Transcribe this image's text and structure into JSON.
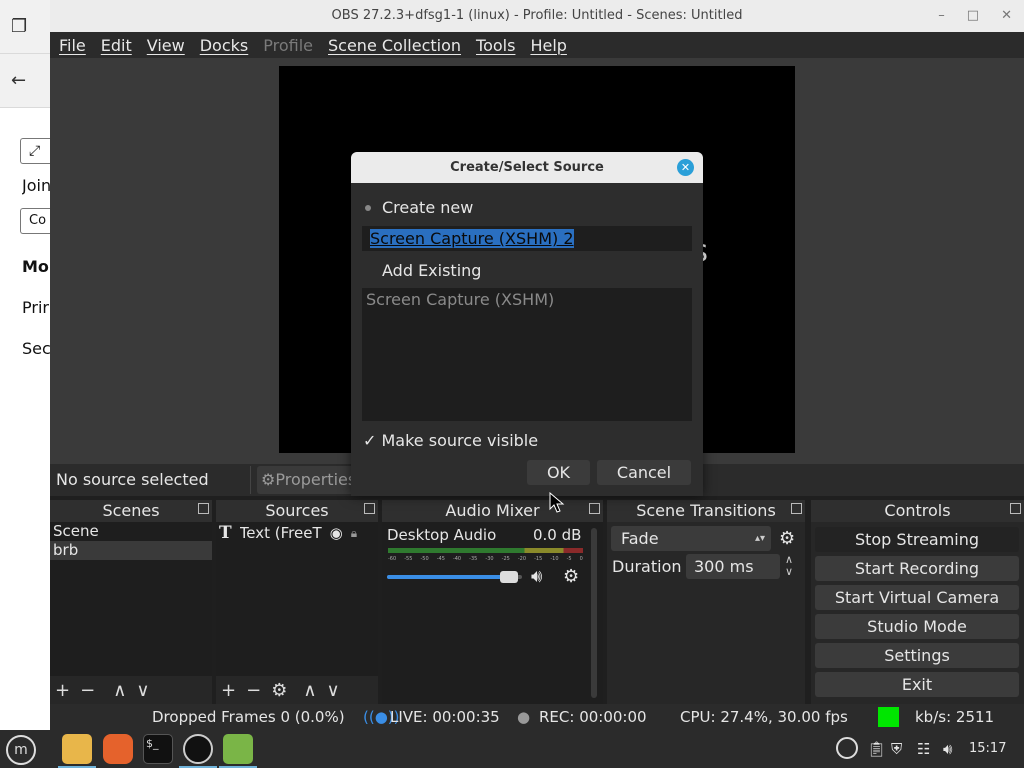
{
  "window": {
    "title": "OBS 27.2.3+dfsg1-1 (linux) - Profile: Untitled - Scenes: Untitled",
    "minimize": "–",
    "maximize": "□",
    "close": "✕"
  },
  "bg_app": {
    "texts": [
      "Join",
      "Co",
      "Mo",
      "Prir",
      "Sec"
    ]
  },
  "menu": {
    "items": [
      "File",
      "Edit",
      "View",
      "Docks",
      "Profile",
      "Scene Collection",
      "Tools",
      "Help"
    ]
  },
  "preview": {
    "text": "os"
  },
  "source_bar": {
    "status": "No source selected",
    "properties": "Properties"
  },
  "docks": {
    "scenes": {
      "title": "Scenes",
      "items": [
        "Scene",
        "brb"
      ]
    },
    "sources": {
      "title": "Sources",
      "items": [
        "Text (FreeT"
      ]
    },
    "audio_mixer": {
      "title": "Audio Mixer",
      "channel": "Desktop Audio",
      "level": "0.0 dB",
      "ticks": [
        "-60",
        "-55",
        "-50",
        "-45",
        "-40",
        "-35",
        "-30",
        "-25",
        "-20",
        "-15",
        "-10",
        "-5",
        "0"
      ],
      "volume": 0.9
    },
    "transitions": {
      "title": "Scene Transitions",
      "transition": "Fade",
      "duration_label": "Duration",
      "duration": "300 ms"
    },
    "controls": {
      "title": "Controls",
      "buttons": [
        "Stop Streaming",
        "Start Recording",
        "Start Virtual Camera",
        "Studio Mode",
        "Settings",
        "Exit"
      ]
    }
  },
  "status": {
    "dropped": "Dropped Frames 0 (0.0%)",
    "live": "LIVE: 00:00:35",
    "rec": "REC: 00:00:00",
    "cpu": "CPU: 27.4%, 30.00 fps",
    "kbs": "kb/s: 2511",
    "indicator_color": "#00e600"
  },
  "dialog": {
    "title": "Create/Select Source",
    "create_new": "Create new",
    "new_name": "Screen Capture (XSHM) 2",
    "add_existing": "Add Existing",
    "existing": [
      "Screen Capture (XSHM)"
    ],
    "visible_check": "✓",
    "visible_label": "Make source visible",
    "ok": "OK",
    "cancel": "Cancel"
  },
  "taskbar": {
    "clock": "15:17"
  }
}
